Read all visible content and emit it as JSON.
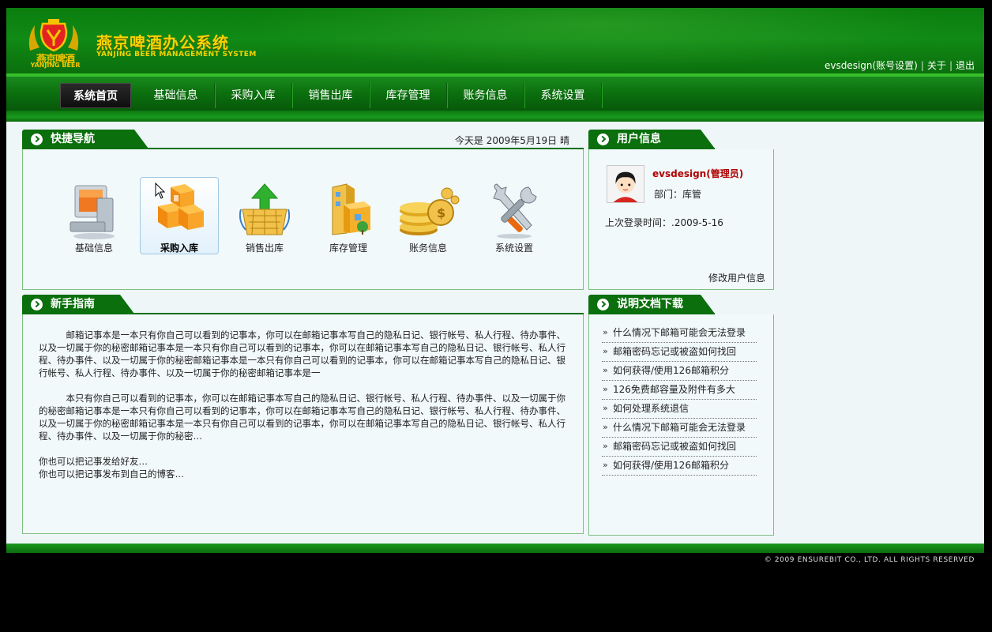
{
  "header": {
    "logo_cn": "燕京啤酒",
    "logo_en": "YANJING BEER",
    "title": "燕京啤酒办公系统",
    "subtitle": "YANJING BEER MANAGEMENT SYSTEM",
    "links": {
      "account": "evsdesign(账号设置)",
      "about": "关于",
      "logout": "退出",
      "sep": "|"
    }
  },
  "nav": {
    "items": [
      "系统首页",
      "基础信息",
      "采购入库",
      "销售出库",
      "库存管理",
      "账务信息",
      "系统设置"
    ],
    "active_index": 0
  },
  "quick_nav": {
    "title": "快捷导航",
    "date": "今天是 2009年5月19日 晴",
    "items": [
      {
        "label": "基础信息",
        "icon": "computer-icon"
      },
      {
        "label": "采购入库",
        "icon": "boxes-icon"
      },
      {
        "label": "销售出库",
        "icon": "basket-upload-icon"
      },
      {
        "label": "库存管理",
        "icon": "warehouse-icon"
      },
      {
        "label": "账务信息",
        "icon": "coins-icon"
      },
      {
        "label": "系统设置",
        "icon": "tools-icon"
      }
    ],
    "active_index": 1
  },
  "user_info": {
    "title": "用户信息",
    "name": "evsdesign(管理员)",
    "dept": "部门：库管",
    "last_login": "上次登录时间：.2009-5-16",
    "edit": "修改用户信息"
  },
  "guide": {
    "title": "新手指南",
    "p1": "邮箱记事本是一本只有你自己可以看到的记事本，你可以在邮箱记事本写自己的隐私日记、银行帐号、私人行程、待办事件、以及一切属于你的秘密邮箱记事本是一本只有你自己可以看到的记事本，你可以在邮箱记事本写自己的隐私日记、银行帐号、私人行程、待办事件、以及一切属于你的秘密邮箱记事本是一本只有你自己可以看到的记事本，你可以在邮箱记事本写自己的隐私日记、银行帐号、私人行程、待办事件、以及一切属于你的秘密邮箱记事本是一",
    "p2": "本只有你自己可以看到的记事本，你可以在邮箱记事本写自己的隐私日记、银行帐号、私人行程、待办事件、以及一切属于你的秘密邮箱记事本是一本只有你自己可以看到的记事本，你可以在邮箱记事本写自己的隐私日记、银行帐号、私人行程、待办事件、以及一切属于你的秘密邮箱记事本是一本只有你自己可以看到的记事本，你可以在邮箱记事本写自己的隐私日记、银行帐号、私人行程、待办事件、以及一切属于你的秘密…",
    "p3": "你也可以把记事发给好友…",
    "p4": "你也可以把记事发布到自己的博客…"
  },
  "docs": {
    "title": "说明文档下载",
    "items": [
      "什么情况下邮箱可能会无法登录",
      "邮箱密码忘记或被盗如何找回",
      "如何获得/使用126邮箱积分",
      "126免费邮容量及附件有多大",
      "如何处理系统退信",
      "什么情况下邮箱可能会无法登录",
      "邮箱密码忘记或被盗如何找回",
      "如何获得/使用126邮箱积分"
    ]
  },
  "footer": {
    "copyright": "© 2009 ENSUREBIT CO., LTD. ALL RIGHTS RESERVED"
  },
  "colors": {
    "brand_green": "#0a6f0c",
    "title_yellow": "#f5d300",
    "user_red": "#b00000"
  }
}
